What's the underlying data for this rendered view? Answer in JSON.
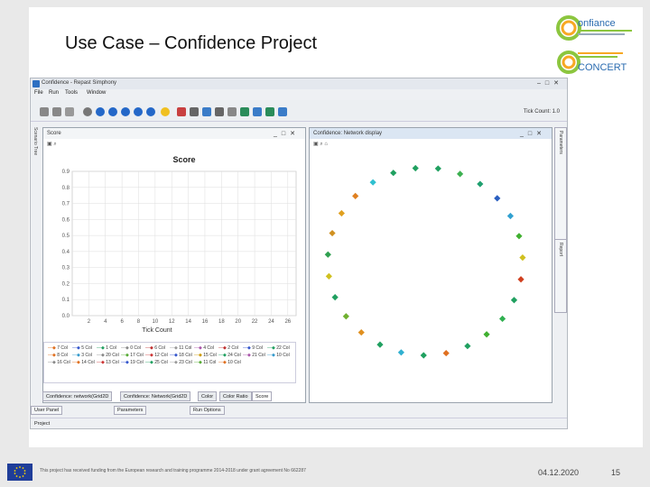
{
  "slide": {
    "title": "Use Case – Confidence Project",
    "footer_text": "This project has received funding from the European research and training programme 2014-2018 under grant agreement No 662287",
    "date": "04.12.2020",
    "page_number": "15"
  },
  "logos": {
    "confiance": "onfiance",
    "concert": "CONCERT"
  },
  "app": {
    "window_title": "Confidence - Repast Simphony",
    "menu": [
      "File",
      "Run",
      "Tools",
      "Window"
    ],
    "tick_count_label": "Tick Count: 1.0",
    "left_tab": "Scenario Tree",
    "right_tab_top": "Parameters",
    "right_tab_bottom": "Report",
    "score_panel": {
      "title": "Score",
      "tabs": [
        "Confidence: network(Grid2D",
        "Confidence: Network(Grid2D",
        "Color",
        "Color Ratio",
        "Score"
      ]
    },
    "network_panel": {
      "title": "Confidence: Network display"
    },
    "bottom_panels": [
      "User Panel",
      "Parameters",
      "Run Options"
    ],
    "status": "Project"
  },
  "chart_data": {
    "type": "line",
    "title": "Score",
    "xlabel": "Tick Count",
    "ylabel": "",
    "xlim": [
      0,
      27
    ],
    "ylim": [
      0.0,
      0.9
    ],
    "x_ticks": [
      2,
      4,
      6,
      8,
      10,
      12,
      14,
      16,
      18,
      20,
      22,
      24,
      26
    ],
    "y_ticks": [
      0.0,
      0.1,
      0.2,
      0.3,
      0.4,
      0.5,
      0.6,
      0.7,
      0.8,
      0.9
    ],
    "grid": true,
    "legend_position": "bottom",
    "series": [
      {
        "name": "7 Col",
        "color": "#e07020"
      },
      {
        "name": "5 Col",
        "color": "#3355cc"
      },
      {
        "name": "1 Col",
        "color": "#20a060"
      },
      {
        "name": "0 Col",
        "color": "#888888"
      },
      {
        "name": "6 Col",
        "color": "#c03030"
      },
      {
        "name": "11 Col",
        "color": "#999999"
      },
      {
        "name": "4 Col",
        "color": "#aa55aa"
      },
      {
        "name": "2 Col",
        "color": "#c03030"
      },
      {
        "name": "9 Col",
        "color": "#3355cc"
      },
      {
        "name": "22 Col",
        "color": "#20a060"
      },
      {
        "name": "8 Col",
        "color": "#e07020"
      },
      {
        "name": "3 Col",
        "color": "#3399cc"
      },
      {
        "name": "20 Col",
        "color": "#888888"
      },
      {
        "name": "17 Col",
        "color": "#55aa33"
      },
      {
        "name": "12 Col",
        "color": "#cc3333"
      },
      {
        "name": "18 Col",
        "color": "#3355cc"
      },
      {
        "name": "15 Col",
        "color": "#cc9900"
      },
      {
        "name": "24 Col",
        "color": "#20a060"
      },
      {
        "name": "21 Col",
        "color": "#aa55aa"
      },
      {
        "name": "10 Col",
        "color": "#3399cc"
      },
      {
        "name": "16 Col",
        "color": "#888888"
      },
      {
        "name": "14 Col",
        "color": "#e07020"
      },
      {
        "name": "13 Col",
        "color": "#cc3333"
      },
      {
        "name": "19 Col",
        "color": "#3355cc"
      },
      {
        "name": "25 Col",
        "color": "#20a060"
      },
      {
        "name": "23 Col",
        "color": "#999999"
      },
      {
        "name": "11 Col",
        "color": "#55aa33"
      },
      {
        "name": "10 Col",
        "color": "#e07020"
      }
    ]
  },
  "network_nodes": [
    {
      "color": "#20a060"
    },
    {
      "color": "#20a060"
    },
    {
      "color": "#3cb050"
    },
    {
      "color": "#20a070"
    },
    {
      "color": "#2a5fc0"
    },
    {
      "color": "#30a0d0"
    },
    {
      "color": "#40b030"
    },
    {
      "color": "#d0c020"
    },
    {
      "color": "#d04020"
    },
    {
      "color": "#20a060"
    },
    {
      "color": "#30b050"
    },
    {
      "color": "#40b030"
    },
    {
      "color": "#20a060"
    },
    {
      "color": "#e07020"
    },
    {
      "color": "#20a060"
    },
    {
      "color": "#30b0d0"
    },
    {
      "color": "#20a060"
    },
    {
      "color": "#e09020"
    },
    {
      "color": "#70b030"
    },
    {
      "color": "#20a060"
    },
    {
      "color": "#d0c020"
    },
    {
      "color": "#30a050"
    },
    {
      "color": "#d09020"
    },
    {
      "color": "#e0a020"
    },
    {
      "color": "#e08020"
    },
    {
      "color": "#30c0d0"
    },
    {
      "color": "#20a060"
    }
  ]
}
